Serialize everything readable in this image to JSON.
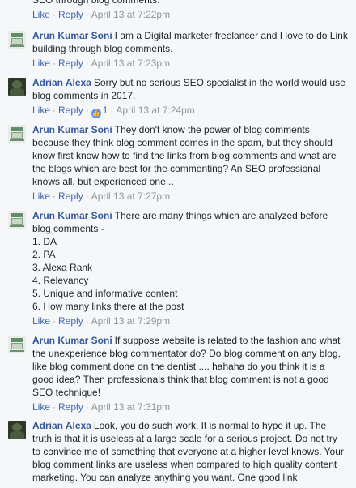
{
  "top_partial": {
    "text": "SEO through blog comments.",
    "like": "Like",
    "reply": "Reply",
    "timestamp": "April 13 at 7:22pm"
  },
  "comments": [
    {
      "author": "Arun Kumar Soni",
      "avatar": "arun-avatar",
      "text": "I am a Digital marketer freelancer and I love to do Link building through blog comments.",
      "like": "Like",
      "reply": "Reply",
      "timestamp": "April 13 at 7:23pm"
    },
    {
      "author": "Adrian Alexa",
      "avatar": "adrian-avatar",
      "text": "Sorry but no serious SEO specialist in the world would use blog comments in 2017.",
      "like": "Like",
      "reply": "Reply",
      "reaction_count": "1",
      "timestamp": "April 13 at 7:24pm"
    },
    {
      "author": "Arun Kumar Soni",
      "avatar": "arun-avatar",
      "text": "They don't know the power of blog comments because they think blog comment comes in the spam, but they should know first know how to find the links from blog comments and what are the blogs which are best for the commenting? An SEO professional knows all, but experienced one...",
      "like": "Like",
      "reply": "Reply",
      "timestamp": "April 13 at 7:27pm"
    },
    {
      "author": "Arun Kumar Soni",
      "avatar": "arun-avatar",
      "text": "There are many things which are analyzed before blog comments -\n1. DA\n2. PA\n3. Alexa Rank\n4. Relevancy\n5. Unique and informative content\n6. How many links there at the post",
      "like": "Like",
      "reply": "Reply",
      "timestamp": "April 13 at 7:29pm"
    },
    {
      "author": "Arun Kumar Soni",
      "avatar": "arun-avatar",
      "text": "If suppose website is related to the fashion and what the unexperience blog commentator do? Do blog comment on any blog, like blog comment done on the dentist .... hahaha do you think it is a good idea? Then professionals think that blog comment is not a good SEO technique!",
      "like": "Like",
      "reply": "Reply",
      "timestamp": "April 13 at 7:31pm"
    },
    {
      "author": "Adrian Alexa",
      "avatar": "adrian-avatar",
      "text": "Look, you do such work. It is normal to hype it up. The truth is that it is useless at a large scale for a serious project. Do not try to convince me of something that everyone at a higher level knows. Your blog comment links are useless when compared to high quality content marketing. You can analyze anything you want. One good link"
    }
  ]
}
